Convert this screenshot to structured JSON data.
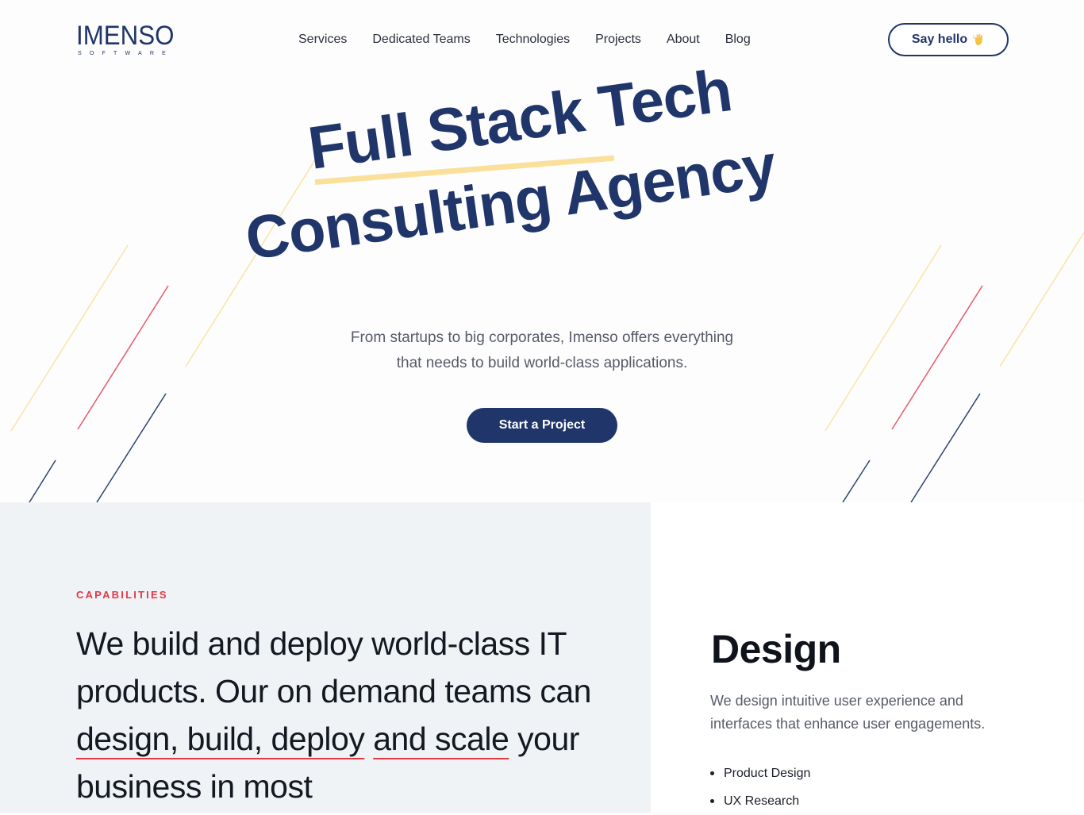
{
  "brand": {
    "name": "IMENSO",
    "sub": "SOFTWARE"
  },
  "nav": {
    "items": [
      "Services",
      "Dedicated Teams",
      "Technologies",
      "Projects",
      "About",
      "Blog"
    ],
    "cta_label": "Say hello",
    "cta_icon": "waving-hand-icon"
  },
  "hero": {
    "headline_line1": "Full Stack Tech",
    "headline_line2": "Consulting Agency",
    "subtext_line1": "From startups to big corporates, Imenso offers everything",
    "subtext_line2": "that needs to build world-class applications.",
    "cta_label": "Start a Project"
  },
  "capabilities": {
    "eyebrow": "CAPABILITIES",
    "text_before": "We build and deploy world-class IT products. Our on demand teams can ",
    "text_highlight_1": "design, build, deploy",
    "text_middle": " ",
    "text_highlight_2": "and scale",
    "text_after": " your business in most"
  },
  "design": {
    "title": "Design",
    "description": "We design intuitive user experience and interfaces that enhance user engagements.",
    "items": [
      "Product Design",
      "UX Research"
    ]
  },
  "colors": {
    "brand_navy": "#203569",
    "accent_red": "#e03a48",
    "accent_yellow": "#fbe09a",
    "capabilities_bg": "#f0f3f6"
  }
}
